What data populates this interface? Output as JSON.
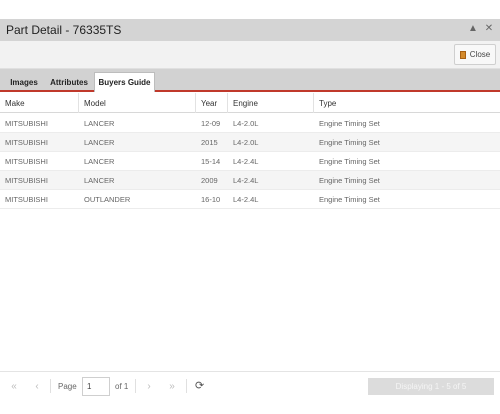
{
  "window": {
    "title": "Part Detail - 76335TS",
    "close_label": "Close"
  },
  "tabs": [
    {
      "label": "Images"
    },
    {
      "label": "Attributes"
    },
    {
      "label": "Buyers Guide"
    }
  ],
  "active_tab": "Buyers Guide",
  "table": {
    "headers": [
      "Make",
      "Model",
      "Year",
      "Engine",
      "Type"
    ],
    "rows": [
      [
        "MITSUBISHI",
        "LANCER",
        "12-09",
        "L4-2.0L",
        "Engine Timing Set"
      ],
      [
        "MITSUBISHI",
        "LANCER",
        "2015",
        "L4-2.0L",
        "Engine Timing Set"
      ],
      [
        "MITSUBISHI",
        "LANCER",
        "15-14",
        "L4-2.4L",
        "Engine Timing Set"
      ],
      [
        "MITSUBISHI",
        "LANCER",
        "2009",
        "L4-2.4L",
        "Engine Timing Set"
      ],
      [
        "MITSUBISHI",
        "OUTLANDER",
        "16-10",
        "L4-2.4L",
        "Engine Timing Set"
      ]
    ]
  },
  "pager": {
    "page_label": "Page",
    "page_value": "1",
    "of_label": "of 1",
    "display_info": "Displaying 1 - 5 of 5"
  },
  "icons": {
    "first": "first-page-icon",
    "prev": "prev-page-icon",
    "next": "next-page-icon",
    "last": "last-page-icon",
    "refresh": "refresh-icon",
    "close": "close-icon",
    "collapse": "collapse-icon",
    "doc": "document-icon"
  },
  "colors": {
    "accent": "#c0392b",
    "titlebar": "#d4d4d4"
  }
}
